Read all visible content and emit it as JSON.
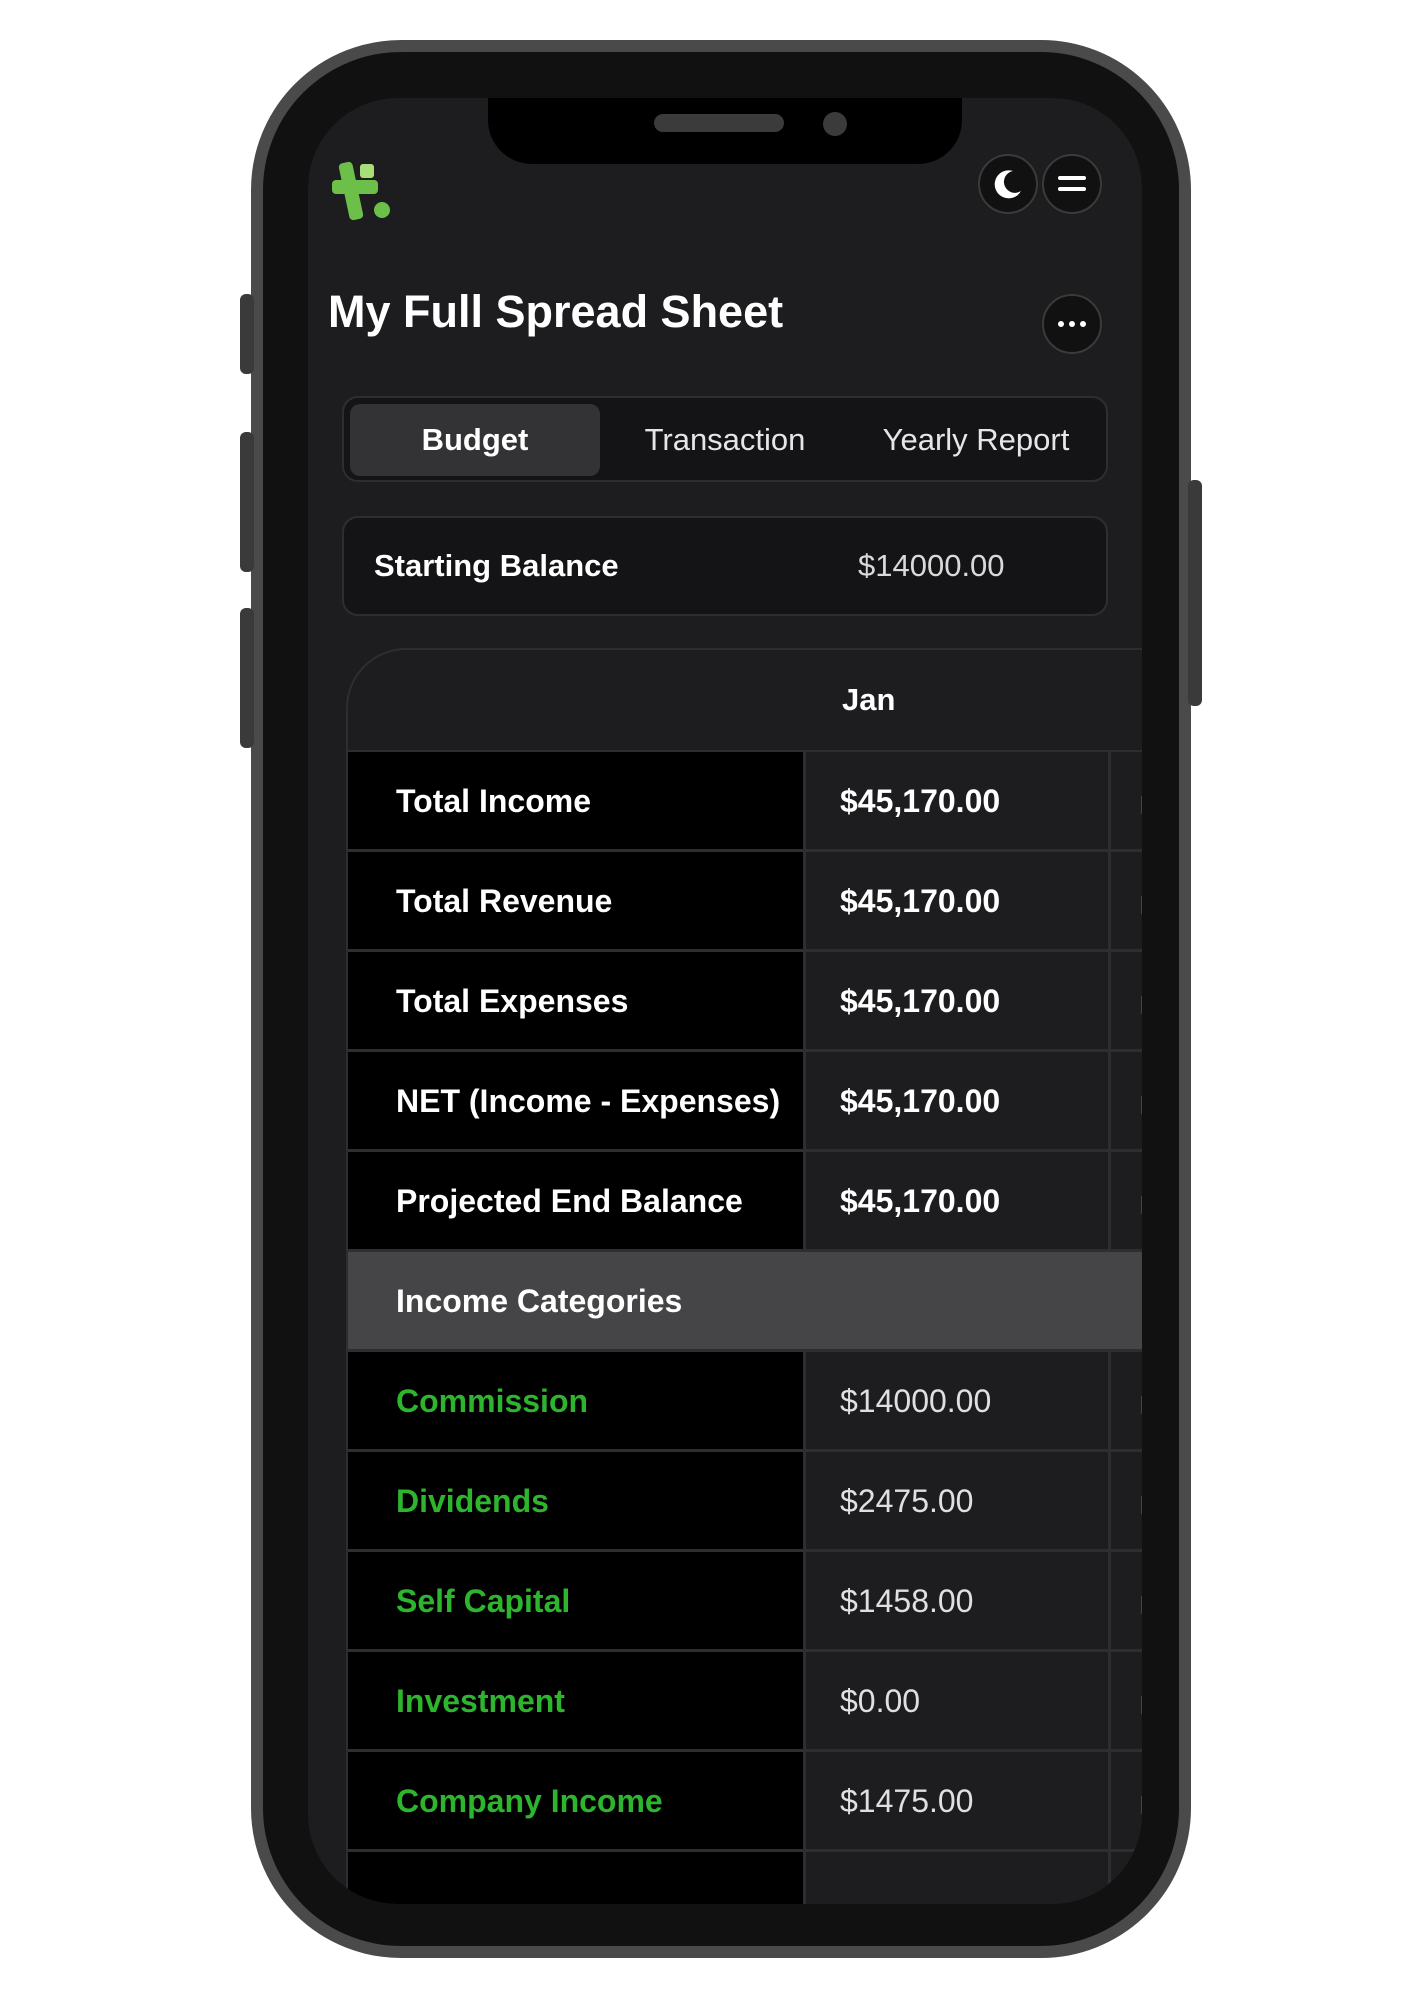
{
  "header": {
    "title": "My Full Spread Sheet",
    "logo_icon": "app-logo-icon",
    "theme_icon": "moon-icon",
    "menu_icon": "hamburger-menu-icon",
    "more_icon": "more-horizontal-icon"
  },
  "tabs": [
    {
      "label": "Budget",
      "active": true
    },
    {
      "label": "Transaction",
      "active": false
    },
    {
      "label": "Yearly Report",
      "active": false
    }
  ],
  "starting_balance": {
    "label": "Starting Balance",
    "value": "$14000.00"
  },
  "table": {
    "month": "Jan",
    "summary_rows": [
      {
        "label": "Total Income",
        "value": "$45,170.00"
      },
      {
        "label": "Total Revenue",
        "value": "$45,170.00"
      },
      {
        "label": "Total Expenses",
        "value": "$45,170.00"
      },
      {
        "label": "NET (Income - Expenses)",
        "value": "$45,170.00"
      },
      {
        "label": "Projected End Balance",
        "value": "$45,170.00"
      }
    ],
    "section_title": "Income Categories",
    "category_rows": [
      {
        "label": "Commission",
        "value": "$14000.00"
      },
      {
        "label": "Dividends",
        "value": "$2475.00"
      },
      {
        "label": "Self Capital",
        "value": "$1458.00"
      },
      {
        "label": "Investment",
        "value": "$0.00"
      },
      {
        "label": "Company Income",
        "value": "$1475.00"
      }
    ]
  },
  "colors": {
    "accent_green": "#2db52d",
    "logo_green": "#6cc04a",
    "background": "#1d1d1f"
  }
}
